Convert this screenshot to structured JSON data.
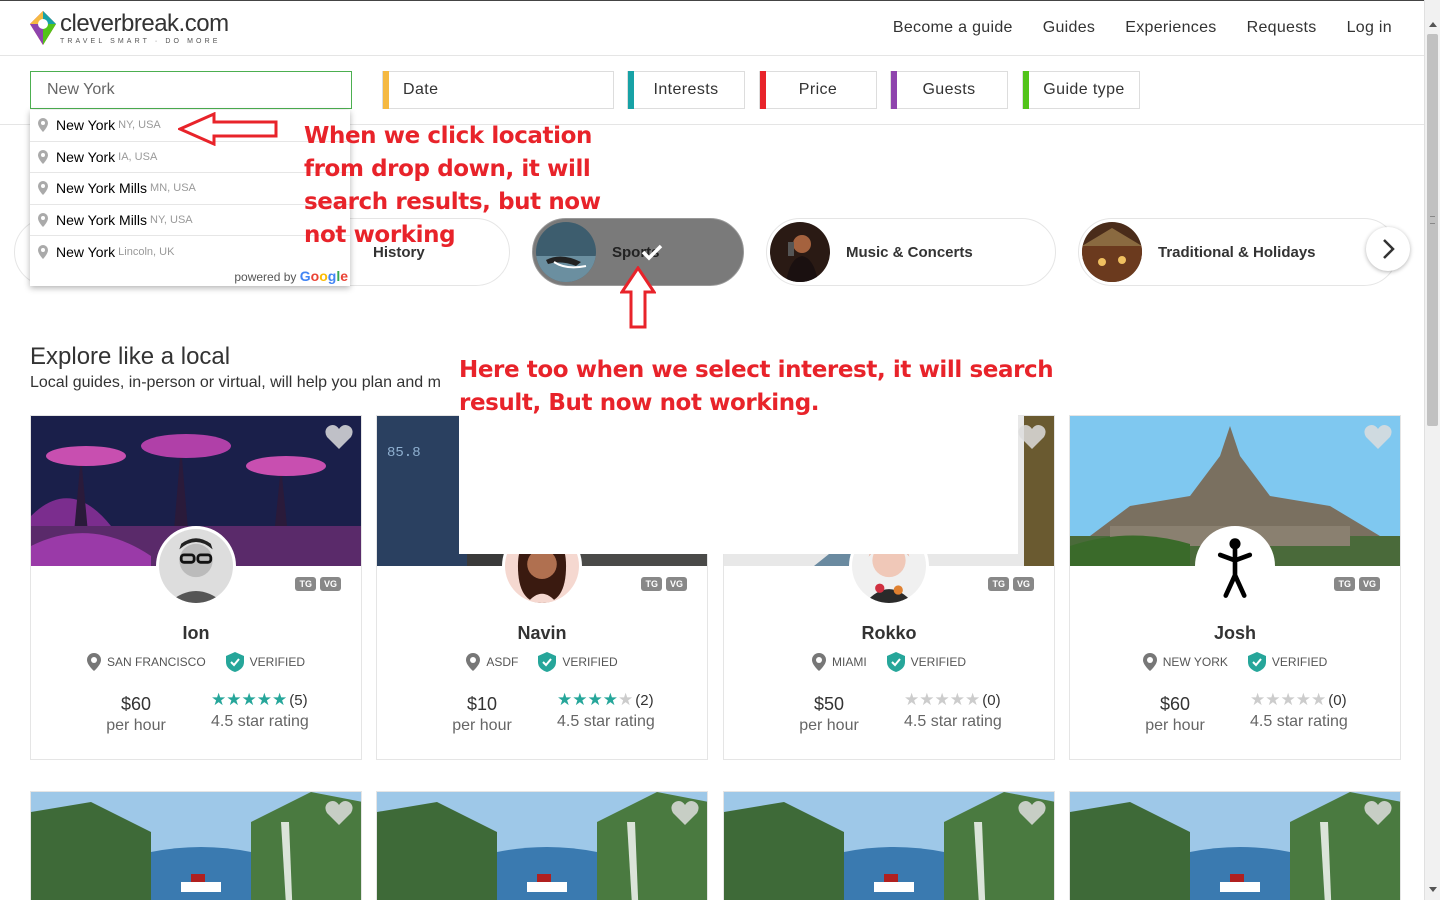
{
  "header": {
    "logo_name": "cleverbreak.com",
    "logo_tagline": "TRAVEL SMART · DO MORE",
    "nav": [
      "Become a guide",
      "Guides",
      "Experiences",
      "Requests",
      "Log in"
    ]
  },
  "filters": {
    "location_value": "New York",
    "buttons": [
      {
        "label": "Date",
        "color": "#f5b942"
      },
      {
        "label": "Interests",
        "color": "#17a2a6"
      },
      {
        "label": "Price",
        "color": "#e8232a"
      },
      {
        "label": "Guests",
        "color": "#8e44ad"
      },
      {
        "label": "Guide type",
        "color": "#52c41a"
      }
    ]
  },
  "dropdown": {
    "items": [
      {
        "main": "New York",
        "sub": "NY, USA"
      },
      {
        "main": "New York",
        "sub": "IA, USA"
      },
      {
        "main": "New York Mills",
        "sub": "MN, USA"
      },
      {
        "main": "New York Mills",
        "sub": "NY, USA"
      },
      {
        "main": "New York",
        "sub": "Lincoln, UK"
      }
    ],
    "powered_by": "powered by",
    "google": "Google"
  },
  "categories": [
    {
      "label": "History",
      "selected": false
    },
    {
      "label": "Sports",
      "selected": true
    },
    {
      "label": "Music & Concerts",
      "selected": false
    },
    {
      "label": "Traditional & Holidays",
      "selected": false
    }
  ],
  "explore": {
    "title": "Explore like a local",
    "subtitle": "Local guides, in-person or virtual, will help you plan and m"
  },
  "guides": [
    {
      "name": "Ion",
      "city": "SAN FRANCISCO",
      "verified": "VERIFIED",
      "price": "$60",
      "per": "per hour",
      "stars": 5,
      "count": "(5)",
      "rating_text": "4.5 star rating",
      "badges": [
        "TG",
        "VG"
      ]
    },
    {
      "name": "Navin",
      "city": "ASDF",
      "verified": "VERIFIED",
      "price": "$10",
      "per": "per hour",
      "stars": 4,
      "count": "(2)",
      "rating_text": "4.5 star rating",
      "badges": [
        "TG",
        "VG"
      ]
    },
    {
      "name": "Rokko",
      "city": "MIAMI",
      "verified": "VERIFIED",
      "price": "$50",
      "per": "per hour",
      "stars": 0,
      "count": "(0)",
      "rating_text": "4.5 star rating",
      "badges": [
        "TG",
        "VG"
      ]
    },
    {
      "name": "Josh",
      "city": "NEW YORK",
      "verified": "VERIFIED",
      "price": "$60",
      "per": "per hour",
      "stars": 0,
      "count": "(0)",
      "rating_text": "4.5 star rating",
      "badges": [
        "TG",
        "VG"
      ]
    }
  ],
  "annotations": {
    "dropdown_note": [
      "When we click location",
      "from drop down, it will",
      "search results, but now",
      "not working"
    ],
    "interest_note": [
      "Here too when we select interest, it will search",
      "result, But now not working."
    ]
  },
  "colors": {
    "accent_green": "#4caf50",
    "star_teal": "#26a69a",
    "annotation_red": "#e8232a"
  }
}
